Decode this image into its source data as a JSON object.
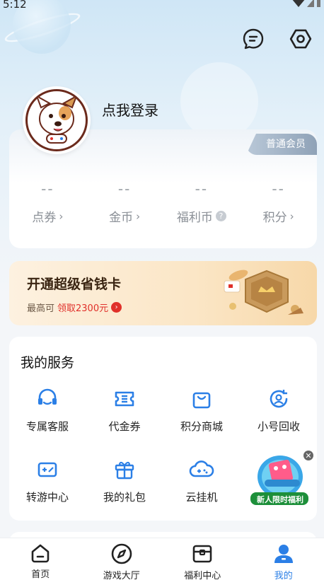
{
  "status_bar": {
    "time": "5:12"
  },
  "header": {
    "login_prompt": "点我登录",
    "message_icon": "message-icon",
    "settings_icon": "settings-hexagon-icon"
  },
  "member": {
    "badge": "普通会员",
    "stats": [
      {
        "value": "--",
        "label": "点券",
        "suffix": "›"
      },
      {
        "value": "--",
        "label": "金币",
        "suffix": "›"
      },
      {
        "value": "--",
        "label": "福利币",
        "suffix": "?"
      },
      {
        "value": "--",
        "label": "积分",
        "suffix": "›"
      }
    ]
  },
  "promo": {
    "title": "开通超级省钱卡",
    "sub_prefix": "最高可",
    "sub_highlight": "领取2300元",
    "arrow": "›"
  },
  "services": {
    "title": "我的服务",
    "items": [
      {
        "label": "专属客服",
        "icon": "headset-icon"
      },
      {
        "label": "代金券",
        "icon": "voucher-icon"
      },
      {
        "label": "积分商城",
        "icon": "shopping-bag-icon"
      },
      {
        "label": "小号回收",
        "icon": "account-recycle-icon"
      },
      {
        "label": "转游中心",
        "icon": "gamepad-transfer-icon"
      },
      {
        "label": "我的礼包",
        "icon": "gift-icon"
      },
      {
        "label": "云挂机",
        "icon": "cloud-gamepad-icon"
      }
    ],
    "ad_banner_text": "新人限时福利"
  },
  "tabbar": {
    "tabs": [
      {
        "label": "首页",
        "icon": "home-icon",
        "active": false
      },
      {
        "label": "游戏大厅",
        "icon": "compass-icon",
        "active": false
      },
      {
        "label": "福利中心",
        "icon": "treasure-box-icon",
        "active": false
      },
      {
        "label": "我的",
        "icon": "user-icon",
        "active": true
      }
    ]
  },
  "colors": {
    "accent": "#2b7fe6",
    "promo_red": "#e0302a",
    "icon_blue": "#2b7fe6"
  }
}
